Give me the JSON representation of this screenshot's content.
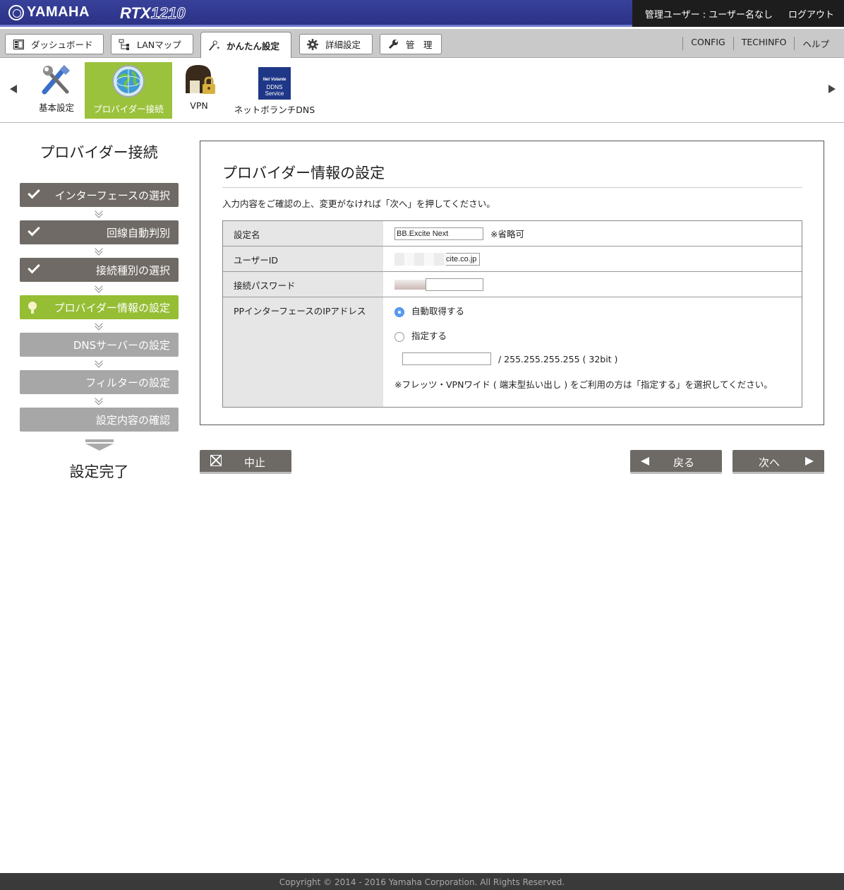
{
  "header": {
    "brand": "YAMAHA",
    "model_prefix": "RTX",
    "model_num": "1210",
    "user_label": "管理ユーザー : ユーザー名なし",
    "logout": "ログアウト"
  },
  "nav": {
    "tabs": [
      {
        "label": "ダッシュボード",
        "icon": "dashboard-icon"
      },
      {
        "label": "LANマップ",
        "icon": "lan-map-icon"
      },
      {
        "label": "かんたん設定",
        "icon": "wand-icon"
      },
      {
        "label": "詳細設定",
        "icon": "gear-icon"
      },
      {
        "label": "管　理",
        "icon": "wrench-icon"
      }
    ],
    "active_tab": "かんたん設定",
    "links": [
      "CONFIG",
      "TECHINFO",
      "ヘルプ"
    ]
  },
  "wizard_icons": [
    {
      "label": "基本設定",
      "icon": "tools-icon"
    },
    {
      "label": "プロバイダー接続",
      "icon": "globe-icon"
    },
    {
      "label": "VPN",
      "icon": "vpn-lock-icon"
    },
    {
      "label": "ネットボランチDNS",
      "icon": "ddns-service-icon",
      "icon_text": [
        "Net Volante",
        "DDNS",
        "Service"
      ]
    }
  ],
  "steps": {
    "title": "プロバイダー接続",
    "items": [
      {
        "label": "インターフェースの選択",
        "state": "done"
      },
      {
        "label": "回線自動判別",
        "state": "done"
      },
      {
        "label": "接続種別の選択",
        "state": "done"
      },
      {
        "label": "プロバイダー情報の設定",
        "state": "current"
      },
      {
        "label": "DNSサーバーの設定",
        "state": "todo"
      },
      {
        "label": "フィルターの設定",
        "state": "todo"
      },
      {
        "label": "設定内容の確認",
        "state": "todo"
      }
    ],
    "complete": "設定完了"
  },
  "main": {
    "title": "プロバイダー情報の設定",
    "description": "入力内容をご確認の上、変更がなければ「次へ」を押してください。",
    "fields": {
      "name_label": "設定名",
      "name_value": "BB.Excite Next",
      "name_note": "※省略可",
      "userid_label": "ユーザーID",
      "userid_value": "cite.co.jp",
      "password_label": "接続パスワード",
      "ip_label": "PPインターフェースのIPアドレス",
      "ip_auto": "自動取得する",
      "ip_manual": "指定する",
      "ip_suffix": "/ 255.255.255.255 ( 32bit )",
      "ip_note": "※フレッツ・VPNワイド ( 端末型払い出し ) をご利用の方は「指定する」を選択してください。"
    }
  },
  "buttons": {
    "cancel": "中止",
    "back": "戻る",
    "next": "次へ"
  },
  "footer": "Copyright © 2014 - 2016 Yamaha Corporation. All Rights Reserved.",
  "colors": {
    "header_blue": "#2b3286",
    "accent_green": "#95be34",
    "step_done": "#6f6a65",
    "step_todo": "#a7a7a7"
  }
}
